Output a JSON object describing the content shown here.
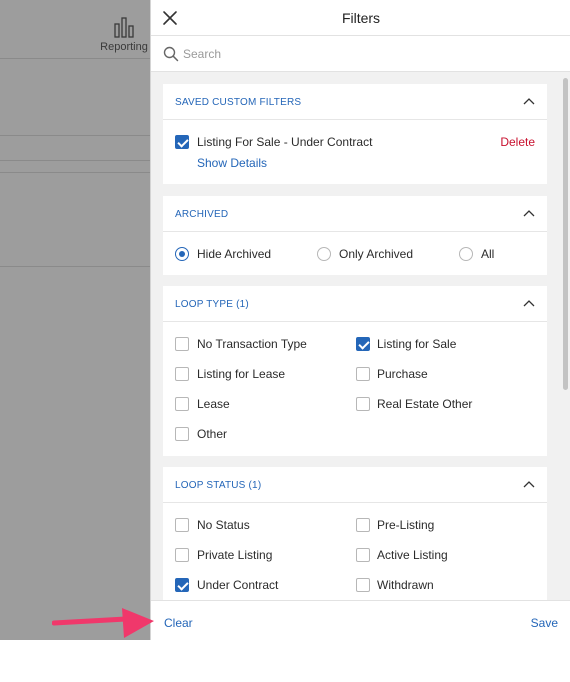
{
  "background": {
    "reporting_label": "Reporting"
  },
  "drawer": {
    "title": "Filters",
    "search": {
      "placeholder": "Search",
      "value": ""
    }
  },
  "sections": {
    "saved_custom_filters": {
      "title": "SAVED CUSTOM FILTERS",
      "item_label": "Listing For Sale - Under Contract",
      "item_checked": true,
      "show_details": "Show Details",
      "delete": "Delete"
    },
    "archived": {
      "title": "ARCHIVED",
      "options": [
        "Hide Archived",
        "Only Archived",
        "All"
      ],
      "selected": "Hide Archived"
    },
    "loop_type": {
      "title": "LOOP TYPE (1)",
      "options": [
        {
          "label": "No Transaction Type",
          "checked": false
        },
        {
          "label": "Listing for Sale",
          "checked": true
        },
        {
          "label": "Listing for Lease",
          "checked": false
        },
        {
          "label": "Purchase",
          "checked": false
        },
        {
          "label": "Lease",
          "checked": false
        },
        {
          "label": "Real Estate Other",
          "checked": false
        },
        {
          "label": "Other",
          "checked": false
        }
      ]
    },
    "loop_status": {
      "title": "LOOP STATUS (1)",
      "options": [
        {
          "label": "No Status",
          "checked": false
        },
        {
          "label": "Pre-Listing",
          "checked": false
        },
        {
          "label": "Private Listing",
          "checked": false
        },
        {
          "label": "Active Listing",
          "checked": false
        },
        {
          "label": "Under Contract",
          "checked": true
        },
        {
          "label": "Withdrawn",
          "checked": false
        }
      ]
    }
  },
  "footer": {
    "clear": "Clear",
    "save": "Save"
  },
  "colors": {
    "accent": "#2466b8",
    "danger": "#c8102e",
    "annotation_arrow": "#f0386b"
  }
}
